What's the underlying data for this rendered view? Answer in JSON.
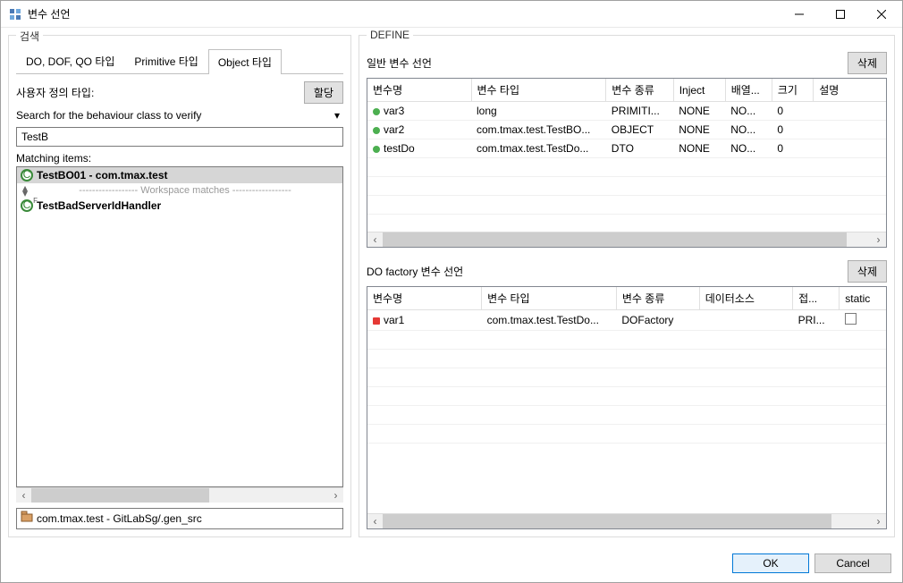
{
  "window": {
    "title": "변수 선언"
  },
  "search": {
    "legend": "검색",
    "tabs": [
      "DO, DOF, QO 타입",
      "Primitive 타입",
      "Object 타입"
    ],
    "active_tab": 2,
    "user_type_label": "사용자 정의 타입:",
    "assign_btn": "할당",
    "behaviour_label": "Search for the behaviour class to verify",
    "search_value": "TestB",
    "matching_label": "Matching items:",
    "items": [
      {
        "label": "TestBO01 - com.tmax.test",
        "selected": true,
        "sup": ""
      },
      {
        "label": "TestBadServerIdHandler",
        "selected": false,
        "sup": "F"
      }
    ],
    "workspace_sep": "Workspace matches",
    "pkg_label": "com.tmax.test - GitLabSg/.gen_src"
  },
  "define": {
    "legend": "DEFINE",
    "section1": {
      "title": "일반 변수 선언",
      "delete_btn": "삭제",
      "headers": [
        "변수명",
        "변수 타입",
        "변수 종류",
        "Inject",
        "배열...",
        "크기",
        "설명"
      ],
      "rows": [
        {
          "name": "var3",
          "type": "long",
          "kind": "PRIMITI...",
          "inject": "NONE",
          "arr": "NO...",
          "size": "0",
          "desc": ""
        },
        {
          "name": "var2",
          "type": "com.tmax.test.TestBO...",
          "kind": "OBJECT",
          "inject": "NONE",
          "arr": "NO...",
          "size": "0",
          "desc": ""
        },
        {
          "name": "testDo",
          "type": "com.tmax.test.TestDo...",
          "kind": "DTO",
          "inject": "NONE",
          "arr": "NO...",
          "size": "0",
          "desc": ""
        }
      ]
    },
    "section2": {
      "title": "DO factory 변수 선언",
      "delete_btn": "삭제",
      "headers": [
        "변수명",
        "변수 타입",
        "변수 종류",
        "데이터소스",
        "접...",
        "static"
      ],
      "rows": [
        {
          "name": "var1",
          "type": "com.tmax.test.TestDo...",
          "kind": "DOFactory",
          "ds": "",
          "acc": "PRI...",
          "static": false
        }
      ]
    }
  },
  "footer": {
    "ok": "OK",
    "cancel": "Cancel"
  }
}
